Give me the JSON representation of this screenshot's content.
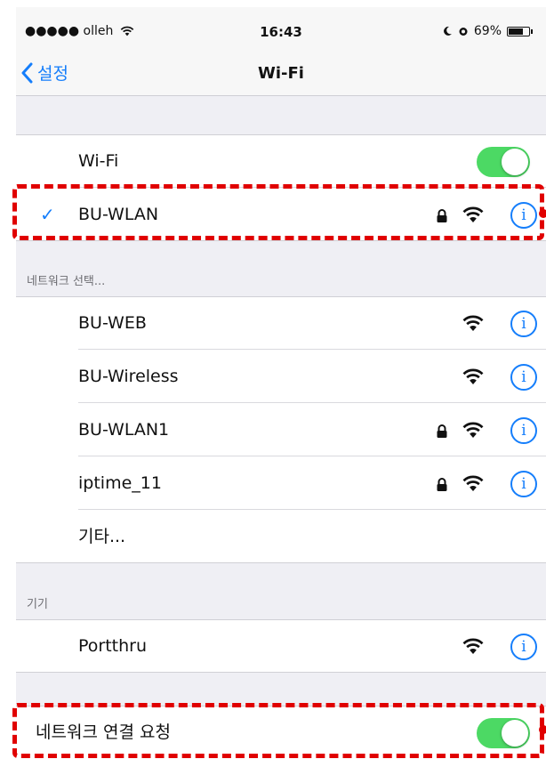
{
  "status_bar": {
    "carrier": "●●●●● olleh",
    "time": "16:43",
    "battery": "69%"
  },
  "nav": {
    "back_label": "설정",
    "title": "Wi-Fi"
  },
  "wifi_toggle": {
    "label": "Wi-Fi",
    "on": true
  },
  "connected_network": {
    "name": "BU-WLAN",
    "secured": true
  },
  "networks_header": "네트워크 선택...",
  "networks": [
    {
      "name": "BU-WEB",
      "secured": false
    },
    {
      "name": "BU-Wireless",
      "secured": false
    },
    {
      "name": "BU-WLAN1",
      "secured": true
    },
    {
      "name": "iptime_11",
      "secured": true
    }
  ],
  "other_label": "기타...",
  "devices_header": "기기",
  "devices": [
    {
      "name": "Portthru"
    }
  ],
  "ask_to_join": {
    "label": "네트워크 연결 요청",
    "on": true
  },
  "colors": {
    "accent": "#157efb",
    "toggle_on": "#4cd964",
    "annotation": "#e00000"
  }
}
